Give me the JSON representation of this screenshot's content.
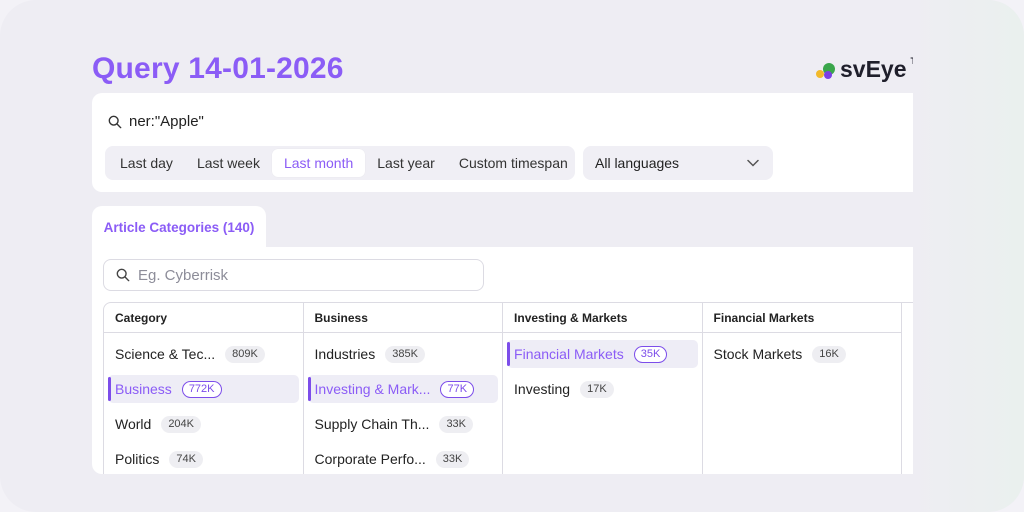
{
  "header": {
    "title": "Query 14-01-2026",
    "logo_text": "svEye",
    "logo_tm": "TM"
  },
  "search": {
    "query": "ner:\"Apple\"",
    "time_ranges": [
      "Last day",
      "Last week",
      "Last month",
      "Last year",
      "Custom timespan"
    ],
    "active_range": "Last month",
    "language": "All languages"
  },
  "tabs": {
    "article_categories": "Article Categories (140)"
  },
  "filter": {
    "placeholder": "Eg. Cyberrisk"
  },
  "columns": [
    {
      "header": "Category",
      "items": [
        {
          "label": "Science & Tec...",
          "count": "809K",
          "selected": false
        },
        {
          "label": "Business",
          "count": "772K",
          "selected": true
        },
        {
          "label": "World",
          "count": "204K",
          "selected": false
        },
        {
          "label": "Politics",
          "count": "74K",
          "selected": false
        }
      ]
    },
    {
      "header": "Business",
      "items": [
        {
          "label": "Industries",
          "count": "385K",
          "selected": false
        },
        {
          "label": "Investing & Mark...",
          "count": "77K",
          "selected": true
        },
        {
          "label": "Supply Chain Th...",
          "count": "33K",
          "selected": false
        },
        {
          "label": "Corporate Perfo...",
          "count": "33K",
          "selected": false
        }
      ]
    },
    {
      "header": "Investing & Markets",
      "items": [
        {
          "label": "Financial Markets",
          "count": "35K",
          "selected": true
        },
        {
          "label": "Investing",
          "count": "17K",
          "selected": false
        }
      ]
    },
    {
      "header": "Financial Markets",
      "items": [
        {
          "label": "Stock Markets",
          "count": "16K",
          "selected": false
        }
      ]
    }
  ],
  "colors": {
    "accent": "#8b5cf6",
    "selected_bar": "#7c4dea",
    "logo_yellow": "#f2b92a",
    "logo_green": "#3aa64b",
    "logo_purple": "#7b3fe4"
  }
}
